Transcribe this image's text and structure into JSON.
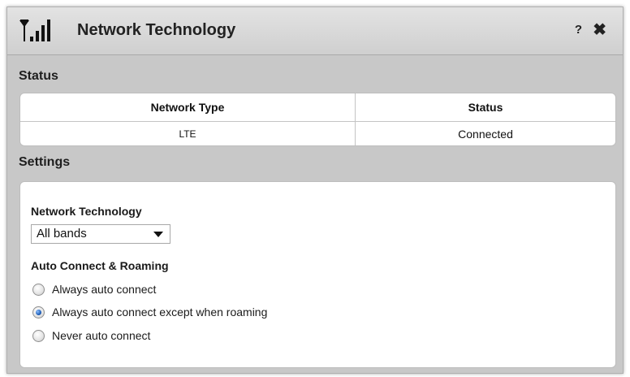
{
  "dialog": {
    "title": "Network Technology",
    "icons": {
      "signal": "signal-bars-icon",
      "help": "help-icon",
      "close": "close-icon"
    },
    "help_label": "?",
    "close_label": "✖"
  },
  "status": {
    "section_title": "Status",
    "columns": [
      "Network Type",
      "Status"
    ],
    "rows": [
      [
        "LTE",
        "Connected"
      ]
    ]
  },
  "settings": {
    "section_title": "Settings",
    "network_technology": {
      "label": "Network Technology",
      "selected": "All bands"
    },
    "auto_connect": {
      "label": "Auto Connect & Roaming",
      "options": [
        {
          "label": "Always auto connect",
          "checked": false
        },
        {
          "label": "Always auto connect except when roaming",
          "checked": true
        },
        {
          "label": "Never auto connect",
          "checked": false
        }
      ]
    }
  },
  "colors": {
    "panel_bg": "#c8c8c8",
    "radio_selected": "#1f5fb8"
  }
}
